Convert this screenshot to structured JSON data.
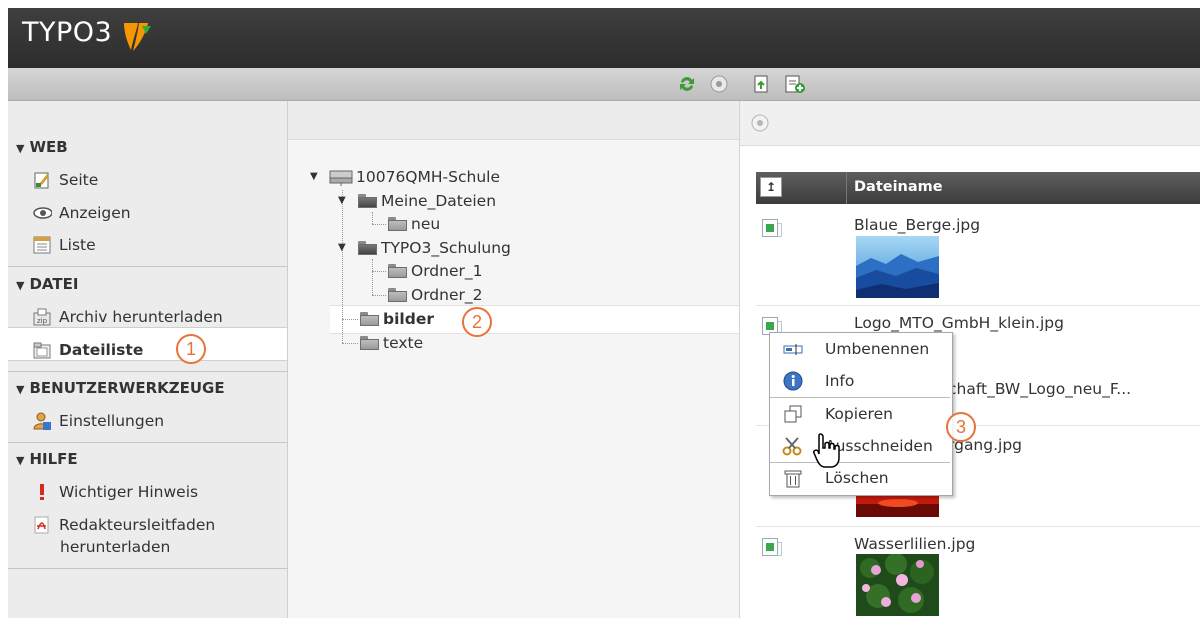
{
  "app": {
    "logo_text": "TYPO3"
  },
  "module_menu": {
    "sections": [
      {
        "title": "WEB",
        "items": [
          "Seite",
          "Anzeigen",
          "Liste"
        ]
      },
      {
        "title": "DATEI",
        "items": [
          "Archiv herunterladen",
          "Dateiliste"
        ]
      },
      {
        "title": "BENUTZERWERKZEUGE",
        "items": [
          "Einstellungen"
        ]
      },
      {
        "title": "HILFE",
        "items": [
          "Wichtiger Hinweis",
          "Redakteursleitfaden",
          "herunterladen"
        ]
      }
    ],
    "active_item": "Dateiliste"
  },
  "tree": {
    "root": "10076QMH-Schule",
    "nodes": [
      "Meine_Dateien",
      "neu",
      "TYPO3_Schulung",
      "Ordner_1",
      "Ordner_2",
      "bilder",
      "texte"
    ],
    "selected": "bilder"
  },
  "file_list": {
    "column_header": "Dateiname",
    "files": [
      "Blaue_Berge.jpg",
      "Logo_MTO_GmbH_klein.jpg",
      "chaft_BW_Logo_neu_F...",
      "rgang.jpg",
      "Wasserlilien.jpg"
    ]
  },
  "context_menu": {
    "items": [
      "Umbenennen",
      "Info",
      "Kopieren",
      "Ausschneiden",
      "Löschen"
    ]
  },
  "callouts": [
    "1",
    "2",
    "3"
  ],
  "colors": {
    "callout": "#e8733a",
    "logo_orange": "#f49700",
    "topbar": "#333333"
  }
}
